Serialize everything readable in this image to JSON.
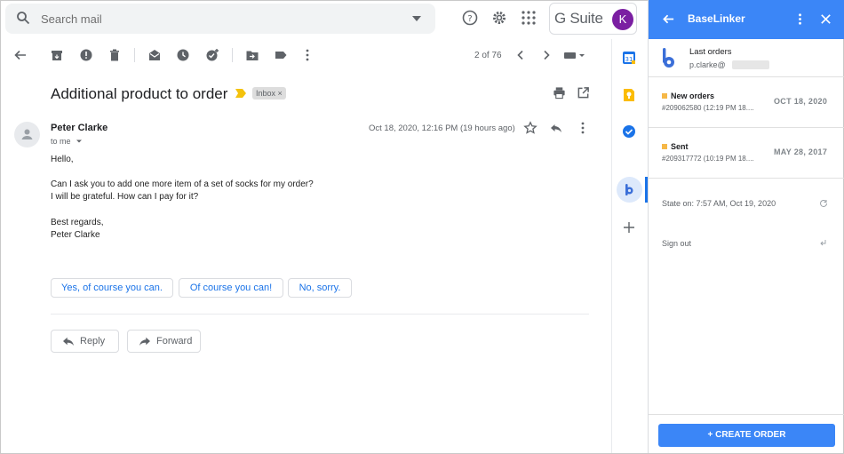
{
  "search": {
    "placeholder": "Search mail"
  },
  "header": {
    "suite_label": "G Suite",
    "avatar_letter": "K"
  },
  "toolbar": {
    "count": "2 of 76"
  },
  "email": {
    "subject": "Additional product to order",
    "label": "Inbox",
    "label_close": "×",
    "sender": "Peter Clarke",
    "to": "to me",
    "date": "Oct 18, 2020, 12:16 PM (19 hours ago)",
    "body": [
      "Hello,",
      "Can I ask you to add one more item of a set of socks for my order?",
      "I will be grateful. How can I pay for it?",
      "Best regards,",
      "Peter Clarke"
    ],
    "smart_replies": [
      "Yes, of course you can.",
      "Of course you can!",
      "No, sorry."
    ],
    "reply_label": "Reply",
    "forward_label": "Forward"
  },
  "panel": {
    "title": "BaseLinker",
    "last_orders": "Last orders",
    "email": "p.clarke@",
    "orders": [
      {
        "status": "New orders",
        "id": "#209062580 (12:19 PM 18....",
        "date": "OCT 18, 2020"
      },
      {
        "status": "Sent",
        "id": "#209317772 (10:19 PM 18....",
        "date": "MAY 28, 2017"
      }
    ],
    "state": "State on: 7:57 AM, Oct 19, 2020",
    "sign_out": "Sign out",
    "create_button": "+ CREATE ORDER"
  },
  "colors": {
    "accent": "#3b86f7",
    "status_dot": "#f6b847",
    "avatar": "#7b1fa2",
    "link": "#1a73e8"
  }
}
